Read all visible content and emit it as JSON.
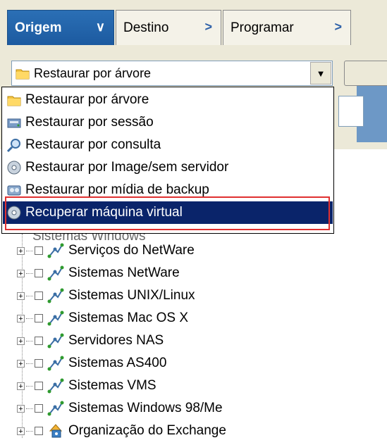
{
  "tabs": [
    {
      "label": "Origem",
      "active": true
    },
    {
      "label": "Destino",
      "active": false
    },
    {
      "label": "Programar",
      "active": false
    }
  ],
  "combo": {
    "selected": "Restaurar por árvore",
    "icon": "folder-icon"
  },
  "dropdown": {
    "options": [
      {
        "label": "Restaurar por árvore",
        "icon": "folder-icon"
      },
      {
        "label": "Restaurar por sessão",
        "icon": "tape-drive-icon"
      },
      {
        "label": "Restaurar por consulta",
        "icon": "search-icon"
      },
      {
        "label": "Restaurar por Image/sem servidor",
        "icon": "disk-image-icon"
      },
      {
        "label": "Restaurar por mídia de backup",
        "icon": "media-icon"
      },
      {
        "label": "Recuperar máquina virtual",
        "icon": "disk-image-icon",
        "selected": true
      }
    ]
  },
  "tree": {
    "partial_item": "Sistemas Windows",
    "items": [
      {
        "label": "Serviços do NetWare",
        "icon": "network-icon"
      },
      {
        "label": "Sistemas NetWare",
        "icon": "network-icon"
      },
      {
        "label": "Sistemas UNIX/Linux",
        "icon": "network-icon"
      },
      {
        "label": "Sistemas Mac OS X",
        "icon": "network-icon"
      },
      {
        "label": "Servidores NAS",
        "icon": "network-icon"
      },
      {
        "label": "Sistemas AS400",
        "icon": "network-icon"
      },
      {
        "label": "Sistemas VMS",
        "icon": "network-icon"
      },
      {
        "label": "Sistemas Windows 98/Me",
        "icon": "network-icon"
      },
      {
        "label": "Organização do Exchange",
        "icon": "exchange-icon"
      }
    ]
  },
  "colors": {
    "tab_active": "#1c5aa0",
    "selection": "#0a246a",
    "highlight_box": "#e03030"
  }
}
